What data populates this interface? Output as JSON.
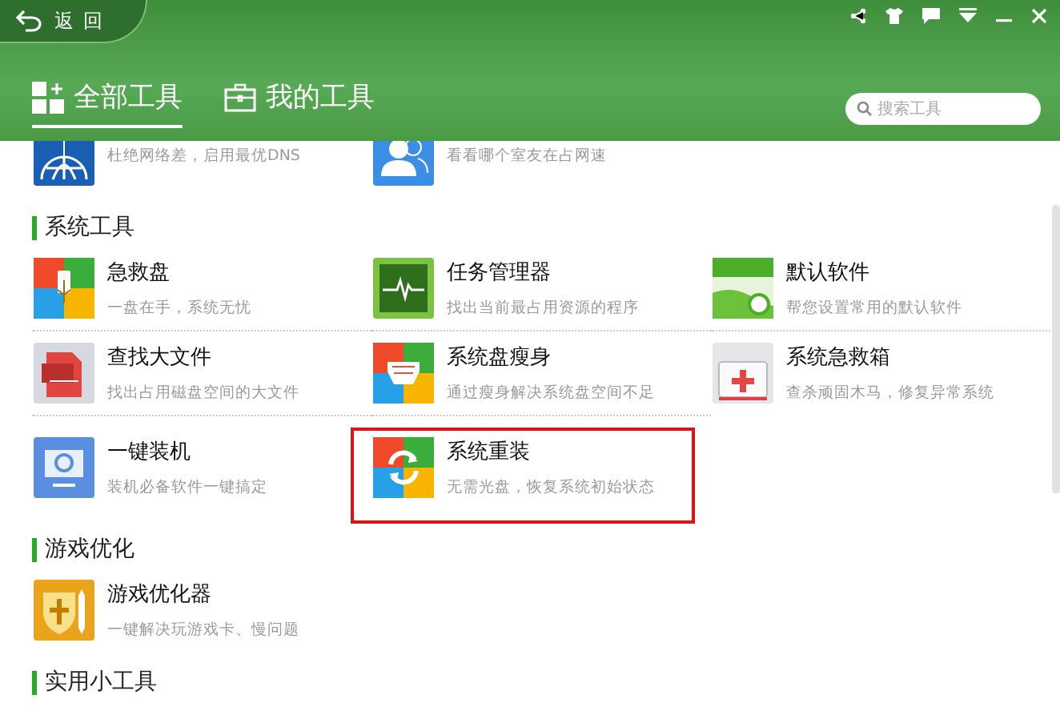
{
  "header": {
    "back_label": "返 回",
    "tabs": [
      {
        "label": "全部工具",
        "selected": true
      },
      {
        "label": "我的工具",
        "selected": false
      }
    ],
    "search": {
      "placeholder": "搜索工具"
    }
  },
  "sections": [
    {
      "tools": [
        {
          "desc": "杜绝网络差，启用最优DNS",
          "selected": false
        },
        {
          "desc": "看看哪个室友在占网速",
          "selected": false
        }
      ]
    },
    {
      "title": "系统工具",
      "tools": [
        {
          "name": "急救盘",
          "desc": "一盘在手，系统无忧",
          "selected": false
        },
        {
          "name": "任务管理器",
          "desc": "找出当前最占用资源的程序",
          "selected": false
        },
        {
          "name": "默认软件",
          "desc": "帮您设置常用的默认软件",
          "selected": false
        },
        {
          "name": "查找大文件",
          "desc": "找出占用磁盘空间的大文件",
          "selected": false
        },
        {
          "name": "系统盘瘦身",
          "desc": "通过瘦身解决系统盘空间不足",
          "selected": false
        },
        {
          "name": "系统急救箱",
          "desc": "查杀顽固木马，修复异常系统",
          "selected": false
        },
        {
          "name": "一键装机",
          "desc": "装机必备软件一键搞定",
          "selected": false
        },
        {
          "name": "系统重装",
          "desc": "无需光盘，恢复系统初始状态",
          "selected": true
        }
      ]
    },
    {
      "title": "游戏优化",
      "tools": [
        {
          "name": "游戏优化器",
          "desc": "一键解决玩游戏卡、慢问题",
          "selected": false
        }
      ]
    },
    {
      "title": "实用小工具"
    }
  ]
}
